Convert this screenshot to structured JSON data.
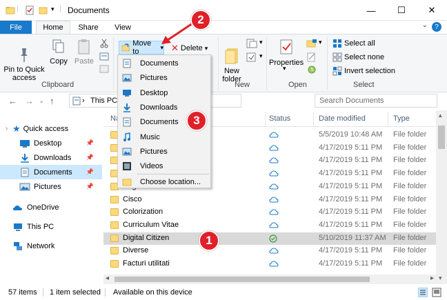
{
  "window": {
    "title": "Documents",
    "controls": {
      "minimize": "—",
      "maximize": "☐",
      "close": "✕"
    }
  },
  "tabs": {
    "file": "File",
    "home": "Home",
    "share": "Share",
    "view": "View",
    "help": "?",
    "collapse": "⌄"
  },
  "ribbon": {
    "pin": "Pin to Quick\naccess",
    "copy": "Copy",
    "paste": "Paste",
    "clipboard": "Clipboard",
    "move_to": "Move to",
    "delete": "Delete",
    "new_folder": "New\nfolder",
    "new": "New",
    "properties": "Properties",
    "open": "Open",
    "select_all": "Select all",
    "select_none": "Select none",
    "invert_selection": "Invert selection",
    "select": "Select",
    "dropdown_arrow": "▾"
  },
  "move_menu": {
    "items": [
      "Documents",
      "Pictures",
      "Desktop",
      "Downloads",
      "Documents",
      "Music",
      "Pictures",
      "Videos"
    ],
    "choose": "Choose location..."
  },
  "address": {
    "back": "←",
    "forward": "→",
    "up": "↑",
    "recent": "⌄",
    "chevron": "›",
    "path": "This PC",
    "search_placeholder": "Search Documents"
  },
  "sidebar": {
    "quick_access": "Quick access",
    "items": [
      "Desktop",
      "Downloads",
      "Documents",
      "Pictures"
    ],
    "onedrive": "OneDrive",
    "this_pc": "This PC",
    "network": "Network",
    "expand": "›",
    "pin": "📌"
  },
  "columns": {
    "name": "Na",
    "status": "Status",
    "date": "Date modified",
    "type": "Type"
  },
  "files": [
    {
      "name": "",
      "date": "5/5/2019 10:48 AM",
      "type": "File folder",
      "status": "cloud"
    },
    {
      "name": "",
      "date": "4/17/2019 5:11 PM",
      "type": "File folder",
      "status": "cloud"
    },
    {
      "name": "",
      "date": "4/17/2019 5:11 PM",
      "type": "File folder",
      "status": "cloud"
    },
    {
      "name": "",
      "date": "4/17/2019 5:11 PM",
      "type": "File folder",
      "status": "cloud"
    },
    {
      "name": "Bogdan",
      "date": "4/17/2019 5:11 PM",
      "type": "File folder",
      "status": "cloud"
    },
    {
      "name": "Cisco",
      "date": "4/17/2019 5:11 PM",
      "type": "File folder",
      "status": "cloud"
    },
    {
      "name": "Colorization",
      "date": "4/17/2019 5:11 PM",
      "type": "File folder",
      "status": "cloud"
    },
    {
      "name": "Curriculum Vitae",
      "date": "4/17/2019 5:11 PM",
      "type": "File folder",
      "status": "cloud"
    },
    {
      "name": "Digital Citizen",
      "date": "5/10/2019 11:37 AM",
      "type": "File folder",
      "status": "available"
    },
    {
      "name": "Diverse",
      "date": "4/17/2019 5:11 PM",
      "type": "File folder",
      "status": "cloud"
    },
    {
      "name": "Facturi utilitati",
      "date": "4/17/2019 5:11 PM",
      "type": "File folder",
      "status": "cloud"
    }
  ],
  "statusbar": {
    "count": "57 items",
    "selected": "1 item selected",
    "availability": "Available on this device"
  },
  "scroll": {
    "left": "◂",
    "right": "▸",
    "up": "▴",
    "down": "▾"
  },
  "callouts": [
    "1",
    "2",
    "3"
  ],
  "colors": {
    "accent": "#1979ca",
    "callout": "#e0202a",
    "selection": "#cce8ff"
  }
}
